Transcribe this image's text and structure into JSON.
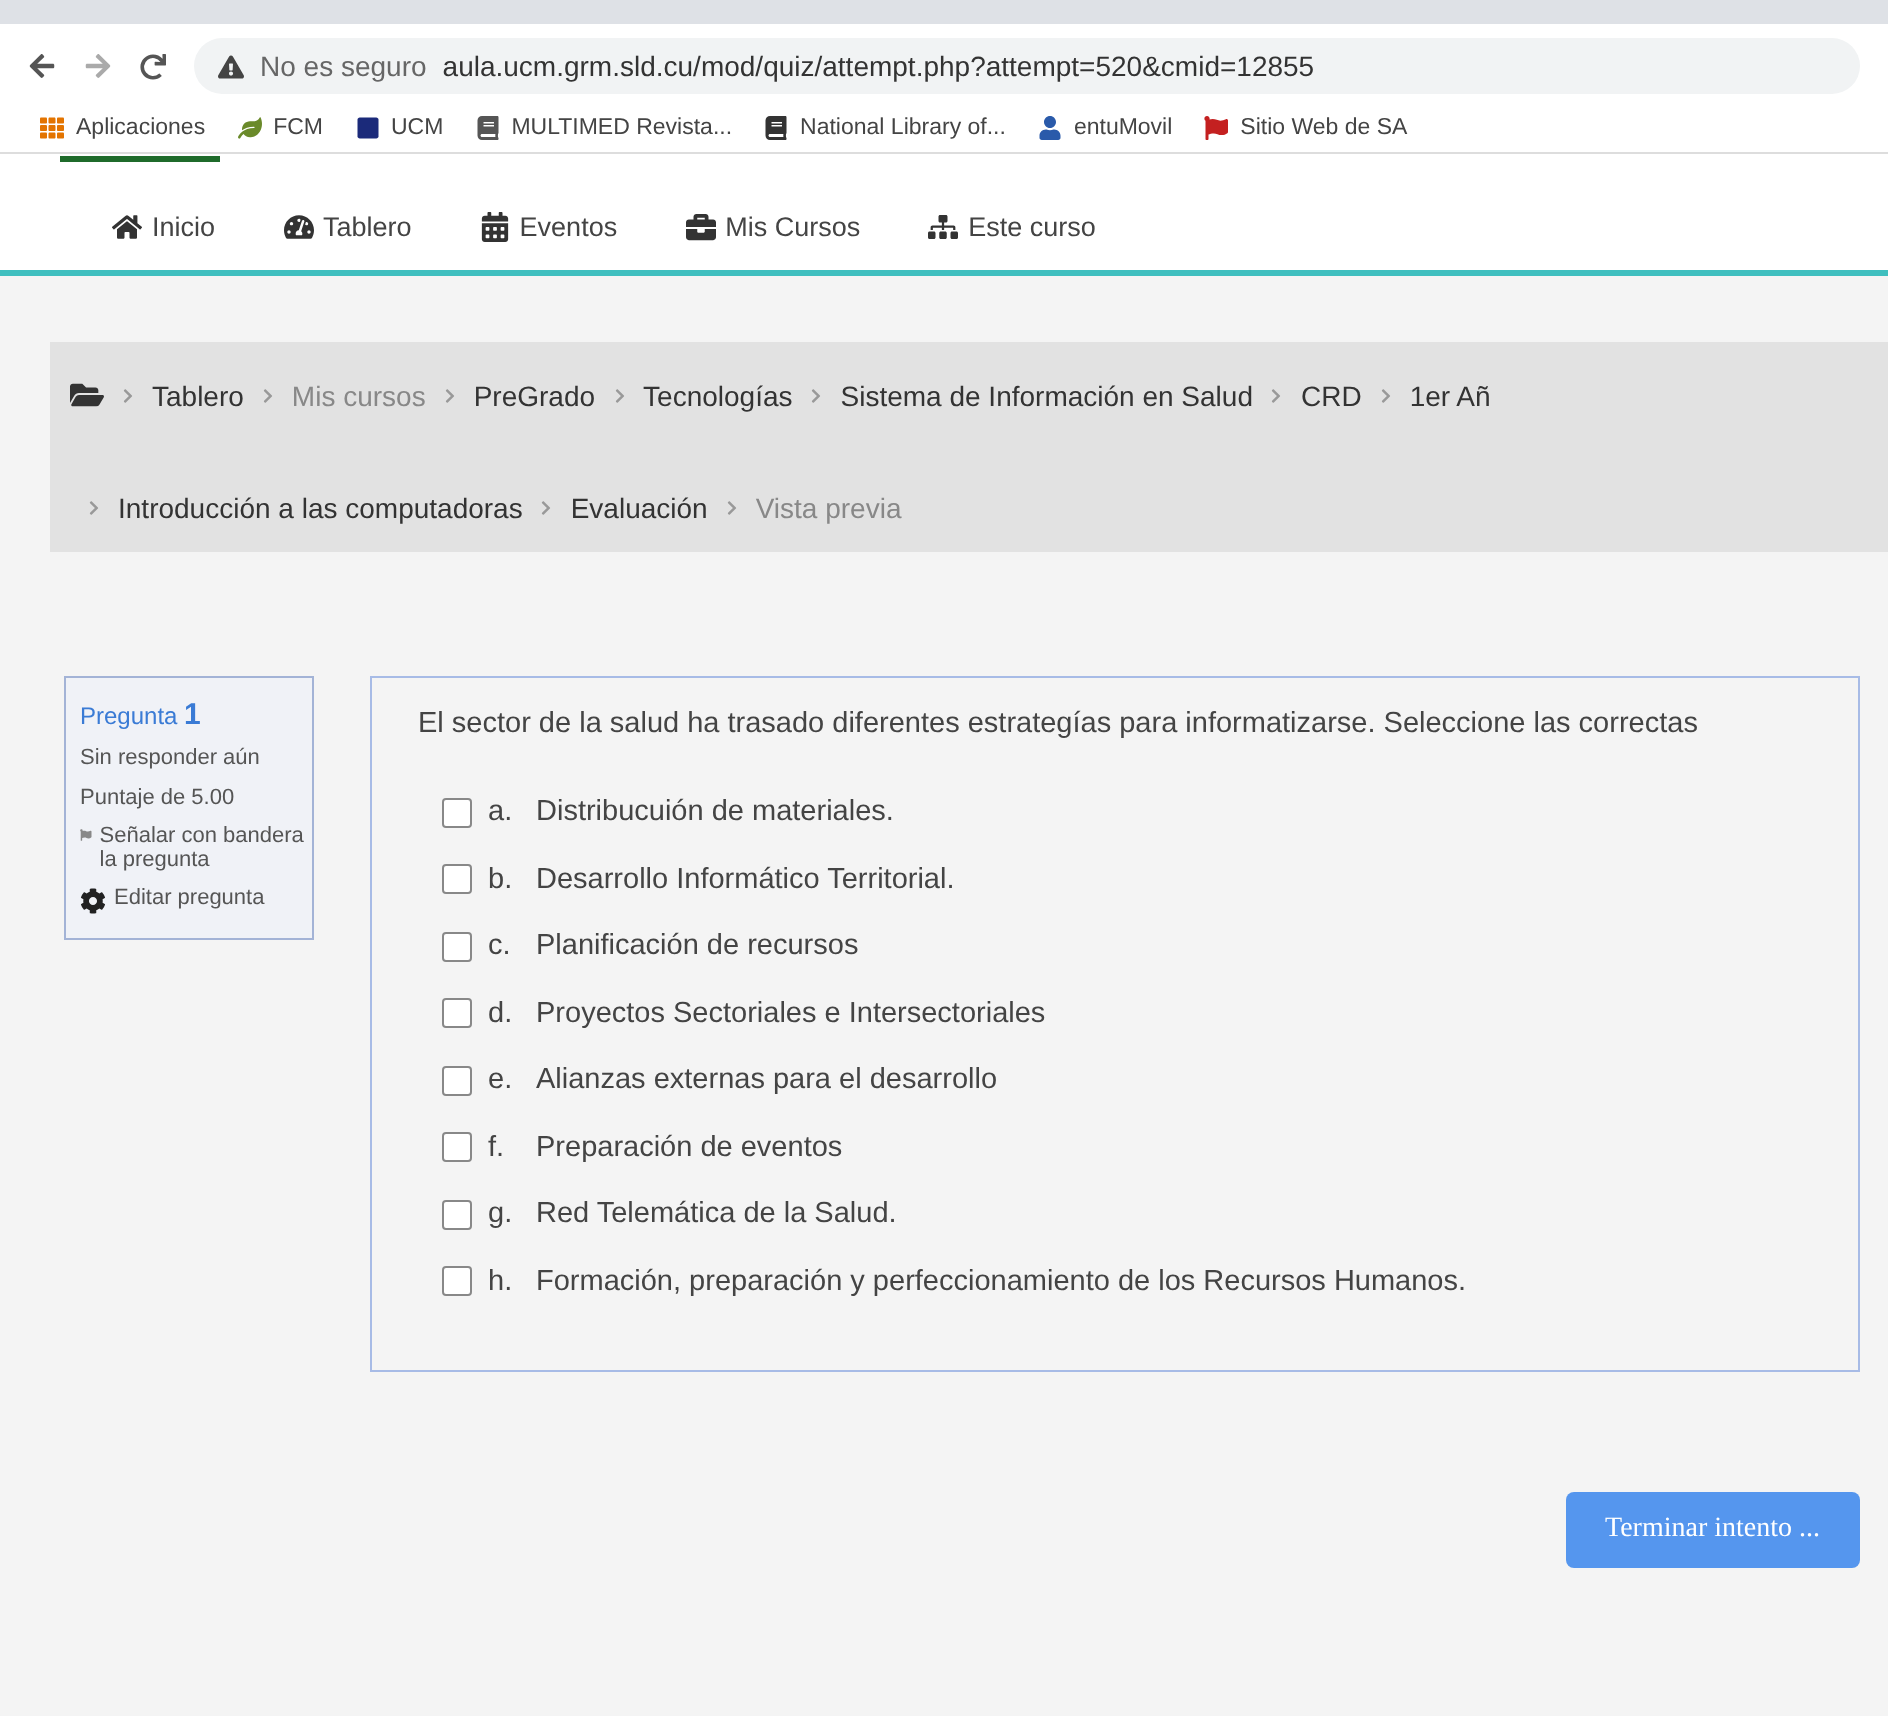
{
  "browser": {
    "security": "No es seguro",
    "url": "aula.ucm.grm.sld.cu/mod/quiz/attempt.php?attempt=520&cmid=12855",
    "bookmarks": [
      {
        "label": "Aplicaciones",
        "kind": "apps"
      },
      {
        "label": "FCM",
        "kind": "plant"
      },
      {
        "label": "UCM",
        "kind": "square"
      },
      {
        "label": "MULTIMED Revista...",
        "kind": "mark"
      },
      {
        "label": "National Library of...",
        "kind": "library"
      },
      {
        "label": "entuMovil",
        "kind": "person"
      },
      {
        "label": "Sitio Web de SA",
        "kind": "flag"
      }
    ]
  },
  "nav": [
    {
      "label": "Inicio",
      "kind": "home"
    },
    {
      "label": "Tablero",
      "kind": "gauge"
    },
    {
      "label": "Eventos",
      "kind": "calendar"
    },
    {
      "label": "Mis Cursos",
      "kind": "briefcase"
    },
    {
      "label": "Este curso",
      "kind": "sitemap"
    }
  ],
  "breadcrumb": [
    {
      "label": "Tablero",
      "disabled": false
    },
    {
      "label": "Mis cursos",
      "disabled": true
    },
    {
      "label": "PreGrado",
      "disabled": false
    },
    {
      "label": "Tecnologías",
      "disabled": false
    },
    {
      "label": "Sistema de Información en Salud",
      "disabled": false
    },
    {
      "label": "CRD",
      "disabled": false
    },
    {
      "label": "1er Añ",
      "disabled": false
    },
    {
      "label": "Introducción a las computadoras",
      "disabled": false
    },
    {
      "label": "Evaluación",
      "disabled": false
    },
    {
      "label": "Vista previa",
      "disabled": true
    }
  ],
  "question_info": {
    "title": "Pregunta",
    "number": "1",
    "status": "Sin responder aún",
    "points": "Puntaje de 5.00",
    "flag": "Señalar con bandera la pregunta",
    "edit": "Editar pregunta"
  },
  "question": {
    "text": "El sector de la salud ha trasado diferentes estrategías para informatizarse. Seleccione las correctas",
    "options": [
      {
        "letter": "a.",
        "text": "Distribucuión de materiales.",
        "checked": false
      },
      {
        "letter": "b.",
        "text": "Desarrollo Informático Territorial.",
        "checked": false
      },
      {
        "letter": "c.",
        "text": "Planificación de recursos",
        "checked": false
      },
      {
        "letter": "d.",
        "text": "Proyectos Sectoriales e Intersectoriales",
        "checked": false
      },
      {
        "letter": "e.",
        "text": "Alianzas externas para el desarrollo",
        "checked": false
      },
      {
        "letter": "f.",
        "text": "Preparación de eventos",
        "checked": false
      },
      {
        "letter": "g.",
        "text": "Red Telemática de la Salud.",
        "checked": false
      },
      {
        "letter": "h.",
        "text": "Formación, preparación y perfeccionamiento de los Recursos Humanos.",
        "checked": false
      }
    ]
  },
  "finish_button": "Terminar intento ..."
}
